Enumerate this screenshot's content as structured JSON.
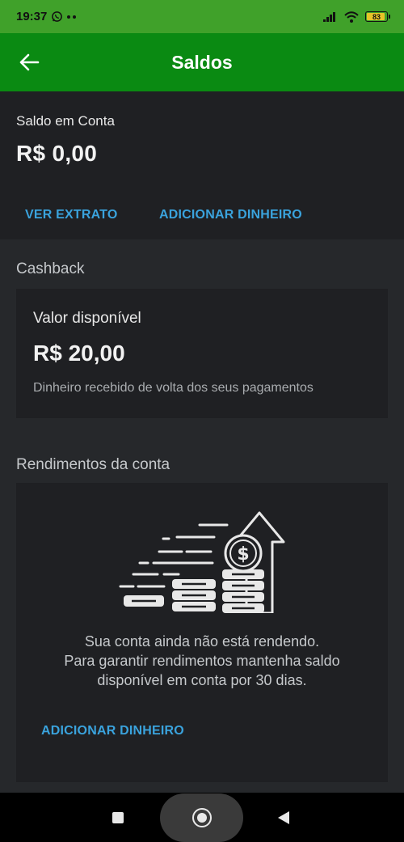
{
  "status_bar": {
    "time": "19:37",
    "battery_level": "83",
    "icons": [
      "whatsapp-icon",
      "dots-icon",
      "signal-icon",
      "wifi-icon",
      "battery-icon"
    ]
  },
  "app_bar": {
    "title": "Saldos",
    "back_icon": "arrow-left-icon",
    "color": "#0a8a12"
  },
  "account": {
    "label": "Saldo em Conta",
    "value": "R$ 0,00",
    "statement_label": "VER EXTRATO",
    "add_money_label": "ADICIONAR DINHEIRO"
  },
  "cashback": {
    "title": "Cashback",
    "available_label": "Valor disponível",
    "available_value": "R$ 20,00",
    "description": "Dinheiro recebido de volta dos seus pagamentos"
  },
  "yield": {
    "title": "Rendimentos da conta",
    "message_lines": [
      "Sua conta ainda não está rendendo.",
      "Para garantir rendimentos mantenha saldo",
      "disponível em conta por 30 dias."
    ],
    "add_money_label": "ADICIONAR DINHEIRO",
    "illustration_icon": "coins-growth-icon"
  },
  "nav_bar": {
    "icons": [
      "recents-icon",
      "home-icon",
      "back-icon"
    ]
  },
  "colors": {
    "accent_link": "#3aa3dd",
    "status_bar": "#40a12a",
    "background": "#26282b",
    "card": "#1f2023"
  }
}
